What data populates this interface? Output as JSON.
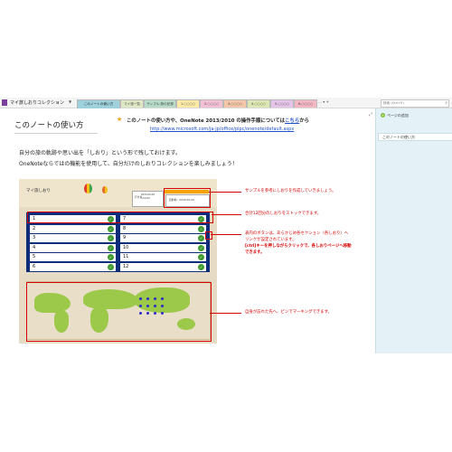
{
  "window": {
    "notebook_title": "マイ旅しおりコレクション",
    "tabs": [
      {
        "label": "このノートの使い方",
        "color": "#9ed1dc",
        "active": true
      },
      {
        "label": "マイ旅一覧",
        "color": "#dfe8c4"
      },
      {
        "label": "サンプル:旅の記録",
        "color": "#b7dcc8"
      },
      {
        "label": "1.○○○○",
        "color": "#fbe9a5"
      },
      {
        "label": "2.○○○○",
        "color": "#f3c0d6"
      },
      {
        "label": "3.○○○○",
        "color": "#f3c7a8"
      },
      {
        "label": "4.○○○○",
        "color": "#dde7b4"
      },
      {
        "label": "5.○○○○",
        "color": "#e4c4e8"
      },
      {
        "label": "6.○○○○",
        "color": "#f3b7c4"
      }
    ],
    "search_placeholder": "検索 (Ctrl+E)"
  },
  "right_pane": {
    "add_page_label": "ページの追加",
    "pages": [
      "このノートの使い方"
    ]
  },
  "page": {
    "title": "このノートの使い方",
    "note_prefix": "このノートの使い方や、OneNote 2013/2010 の操作手順については",
    "note_link": "こちら",
    "note_suffix": "から",
    "url": "http://www.microsoft.com/ja-jp/office/pipc/onenote/default.aspx",
    "intro_lines": [
      "自分の旅の軌跡や思い出を「しおり」という形で残しておけます。",
      "OneNoteならではの機能を使用して、自分だけのしおりコレクションを楽しみましょう！"
    ]
  },
  "image": {
    "header_title": "マイ旅しおり",
    "card_label": "行き先",
    "card_dates": [
      "2015-XX-XX",
      "~XX-XX"
    ],
    "card2_label": "目的地 : XXXX-XX-XX",
    "slots_left": [
      "1",
      "2",
      "3",
      "4",
      "5",
      "6"
    ],
    "slots_right": [
      "7",
      "8",
      "9",
      "10",
      "11",
      "12"
    ]
  },
  "annotations": {
    "a1": "サンプルを参考にしおりを作成していきましょう。",
    "a2": "合計12回分のしおりをストックできます。",
    "a3_line1": "表内のボタンは、あらかじめ各セクション（各しおり）へ",
    "a3_line2": "リンクが設定されています。",
    "a3_bold1": "[ctrl]キーを押しながらクリックで、各しおりページへ移動",
    "a3_bold2": "できます。",
    "a4": "自身が訪れた先へ、ピンでマーキングできます。"
  },
  "colors": {
    "accent_red": "#d60000",
    "grid_navy": "#0b2d7a",
    "button_green": "#3e9b2f",
    "pane_bg": "#e4f2f7"
  }
}
